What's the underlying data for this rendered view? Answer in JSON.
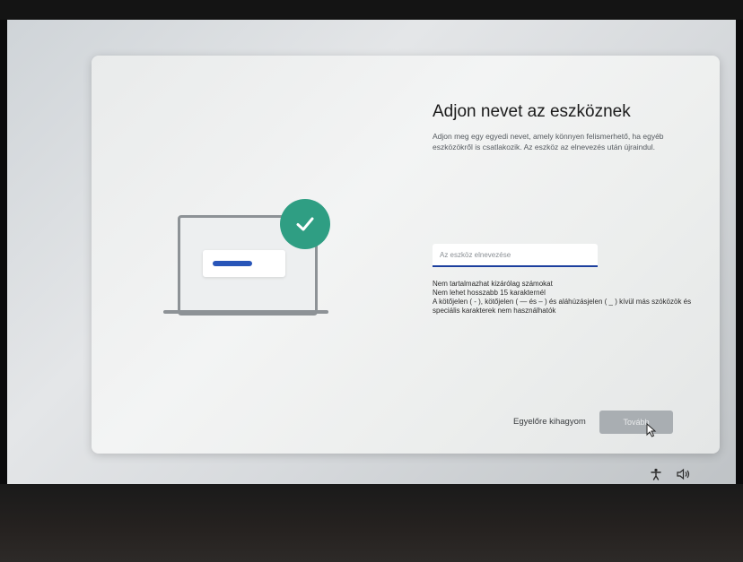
{
  "dialog": {
    "title": "Adjon nevet az eszköznek",
    "subtitle": "Adjon meg egy egyedi nevet, amely könnyen felismerhető, ha egyéb eszközökről is csatlakozik. Az eszköz az elnevezés után újraindul.",
    "input": {
      "value": "",
      "placeholder": "Az eszköz elnevezése"
    },
    "rules": [
      "Nem tartalmazhat kizárólag számokat",
      "Nem lehet hosszabb 15 karakternél",
      "A kötőjelen ( - ), kötőjelen ( — és – ) és aláhúzásjelen ( _ ) kívül más szóközök és speciális karakterek nem használhatók"
    ],
    "skip_label": "Egyelőre kihagyom",
    "next_label": "Tovább"
  },
  "colors": {
    "accent_check": "#2f9e83",
    "input_underline": "#1c3f9e",
    "next_disabled": "#a9aeb2"
  },
  "icons": {
    "check": "check-icon",
    "accessibility": "accessibility-icon",
    "volume": "volume-icon",
    "cursor": "mouse-pointer-icon"
  }
}
